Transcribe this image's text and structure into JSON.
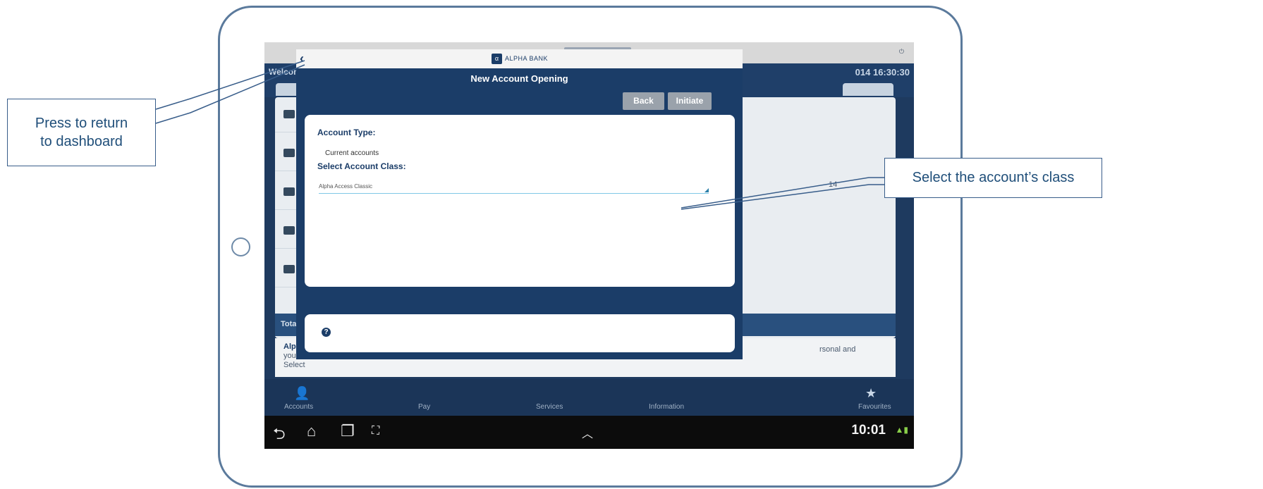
{
  "background_app": {
    "welcome_text": "Welcome, ca",
    "datetime": "014 16:30:30",
    "nav_items": [
      "Accounts",
      "Pay",
      "Services",
      "Information",
      "Favourites"
    ],
    "total_label": "Total",
    "info_fragment_1": "Alpha",
    "info_fragment_2": "you m",
    "info_fragment_3": "Select",
    "right_fragment_1": "rsonal and",
    "right_fragment_2": "14"
  },
  "android_bar": {
    "clock": "10:01"
  },
  "dialog": {
    "logo_text": "ALPHA BANK",
    "title": "New Account Opening",
    "back_button": "Back",
    "initiate_button": "Initiate",
    "account_type_label": "Account Type:",
    "account_type_value": "Current accounts",
    "account_class_label": "Select Account Class:",
    "account_class_value": "Alpha Access Classic"
  },
  "callouts": {
    "left_line1": "Press to return",
    "left_line2": "to dashboard",
    "right": "Select the account’s class"
  },
  "colors": {
    "app_blue": "#1b3d68",
    "callout_border": "#385d8a",
    "callout_text": "#1f4e79",
    "button_gray": "#9aa2ab"
  }
}
